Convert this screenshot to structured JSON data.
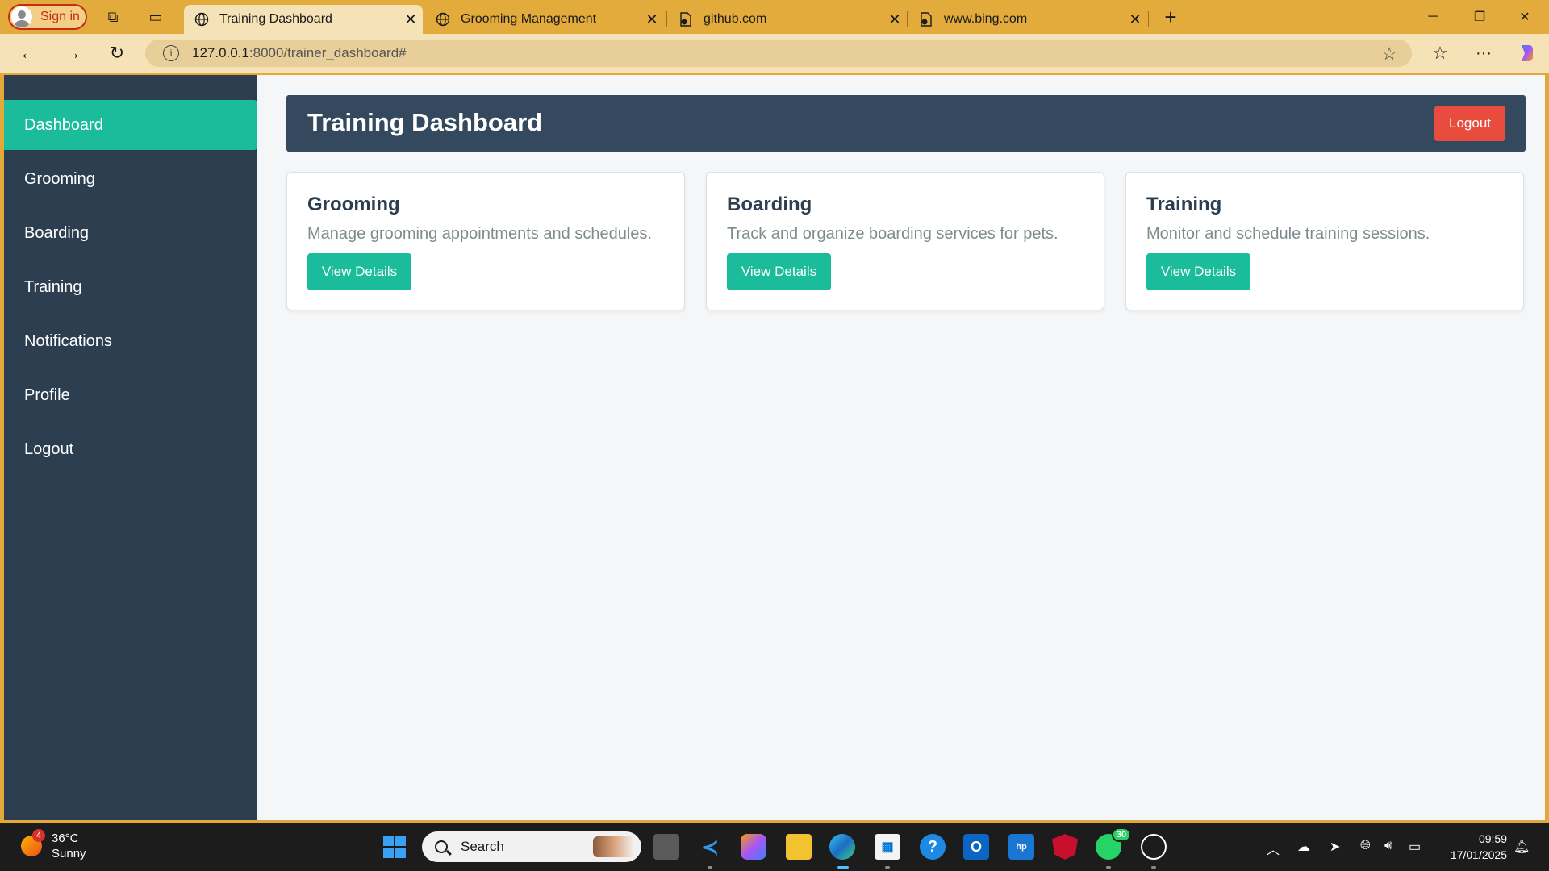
{
  "browser": {
    "signin_label": "Sign in",
    "tabs": [
      {
        "title": "Training Dashboard",
        "active": true
      },
      {
        "title": "Grooming Management",
        "active": false
      },
      {
        "title": "github.com",
        "active": false
      },
      {
        "title": "www.bing.com",
        "active": false
      }
    ],
    "url_host": "127.0.0.1",
    "url_rest": ":8000/trainer_dashboard#"
  },
  "sidebar": {
    "items": [
      {
        "label": "Dashboard",
        "active": true
      },
      {
        "label": "Grooming"
      },
      {
        "label": "Boarding"
      },
      {
        "label": "Training"
      },
      {
        "label": "Notifications"
      },
      {
        "label": "Profile"
      },
      {
        "label": "Logout"
      }
    ]
  },
  "header": {
    "title": "Training Dashboard",
    "logout_label": "Logout"
  },
  "cards": [
    {
      "title": "Grooming",
      "description": "Manage grooming appointments and schedules.",
      "button": "View Details"
    },
    {
      "title": "Boarding",
      "description": "Track and organize boarding services for pets.",
      "button": "View Details"
    },
    {
      "title": "Training",
      "description": "Monitor and schedule training sessions.",
      "button": "View Details"
    }
  ],
  "taskbar": {
    "weather_badge": "4",
    "temperature": "36°C",
    "condition": "Sunny",
    "search_label": "Search",
    "whatsapp_badge": "30",
    "time": "09:59",
    "date": "17/01/2025"
  },
  "colors": {
    "sidebar_bg": "#2c3e50",
    "accent": "#1abc9c",
    "header_bg": "#34495e",
    "danger": "#e74c3c",
    "browser_frame": "#e3ab3c"
  }
}
